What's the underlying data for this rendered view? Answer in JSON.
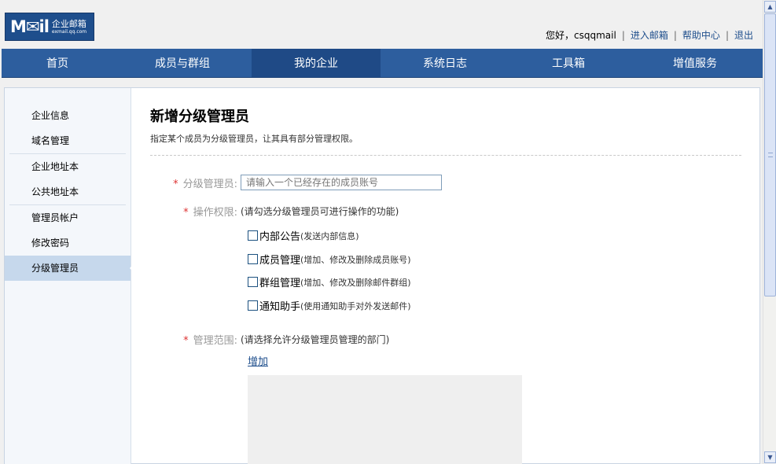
{
  "logo": {
    "mark": "M✉il",
    "cn": "企业邮箱",
    "en": "exmail.qq.com"
  },
  "user_bar": {
    "greeting": "您好，csqqmail",
    "links": [
      "进入邮箱",
      "帮助中心",
      "退出"
    ]
  },
  "nav": {
    "items": [
      "首页",
      "成员与群组",
      "我的企业",
      "系统日志",
      "工具箱",
      "增值服务"
    ],
    "active_index": 2
  },
  "sidebar": {
    "groups": [
      [
        "企业信息",
        "域名管理"
      ],
      [
        "企业地址本",
        "公共地址本"
      ],
      [
        "管理员帐户",
        "修改密码",
        "分级管理员"
      ]
    ],
    "active": "分级管理员"
  },
  "main": {
    "title": "新增分级管理员",
    "subtitle": "指定某个成员为分级管理员，让其具有部分管理权限。",
    "admin_label": "分级管理员:",
    "admin_placeholder": "请输入一个已经存在的成员账号",
    "perm_label": "操作权限:",
    "perm_hint": "(请勾选分级管理员可进行操作的功能)",
    "permissions": [
      {
        "title": "内部公告",
        "desc": "(发送内部信息)"
      },
      {
        "title": "成员管理",
        "desc": "(增加、修改及删除成员账号)"
      },
      {
        "title": "群组管理",
        "desc": "(增加、修改及删除邮件群组)"
      },
      {
        "title": "通知助手",
        "desc": "(使用通知助手对外发送邮件)"
      }
    ],
    "scope_label": "管理范围:",
    "scope_hint": "(请选择允许分级管理员管理的部门)",
    "add_link": "增加"
  },
  "colors": {
    "nav_bg": "#2d5e9e",
    "nav_active": "#1f4a86",
    "link": "#1e4e8c",
    "required_star": "#d33333"
  }
}
